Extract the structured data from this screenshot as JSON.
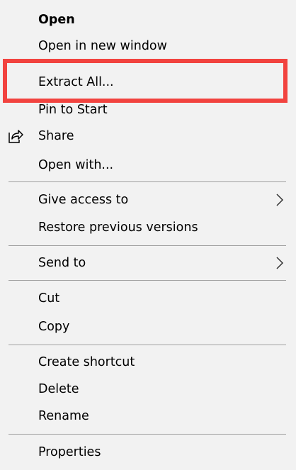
{
  "context_menu": {
    "open": "Open",
    "open_new_window": "Open in new window",
    "extract_all": "Extract All...",
    "pin_to_start": "Pin to Start",
    "share": "Share",
    "open_with": "Open with...",
    "give_access_to": "Give access to",
    "restore_previous_versions": "Restore previous versions",
    "send_to": "Send to",
    "cut": "Cut",
    "copy": "Copy",
    "create_shortcut": "Create shortcut",
    "delete": "Delete",
    "rename": "Rename",
    "properties": "Properties"
  },
  "icons": {
    "share": "share-icon",
    "submenu": "chevron-right-icon"
  },
  "colors": {
    "menu_background": "#f2f2f2",
    "separator": "#a0a0a0",
    "highlight_border": "#f2433f"
  }
}
